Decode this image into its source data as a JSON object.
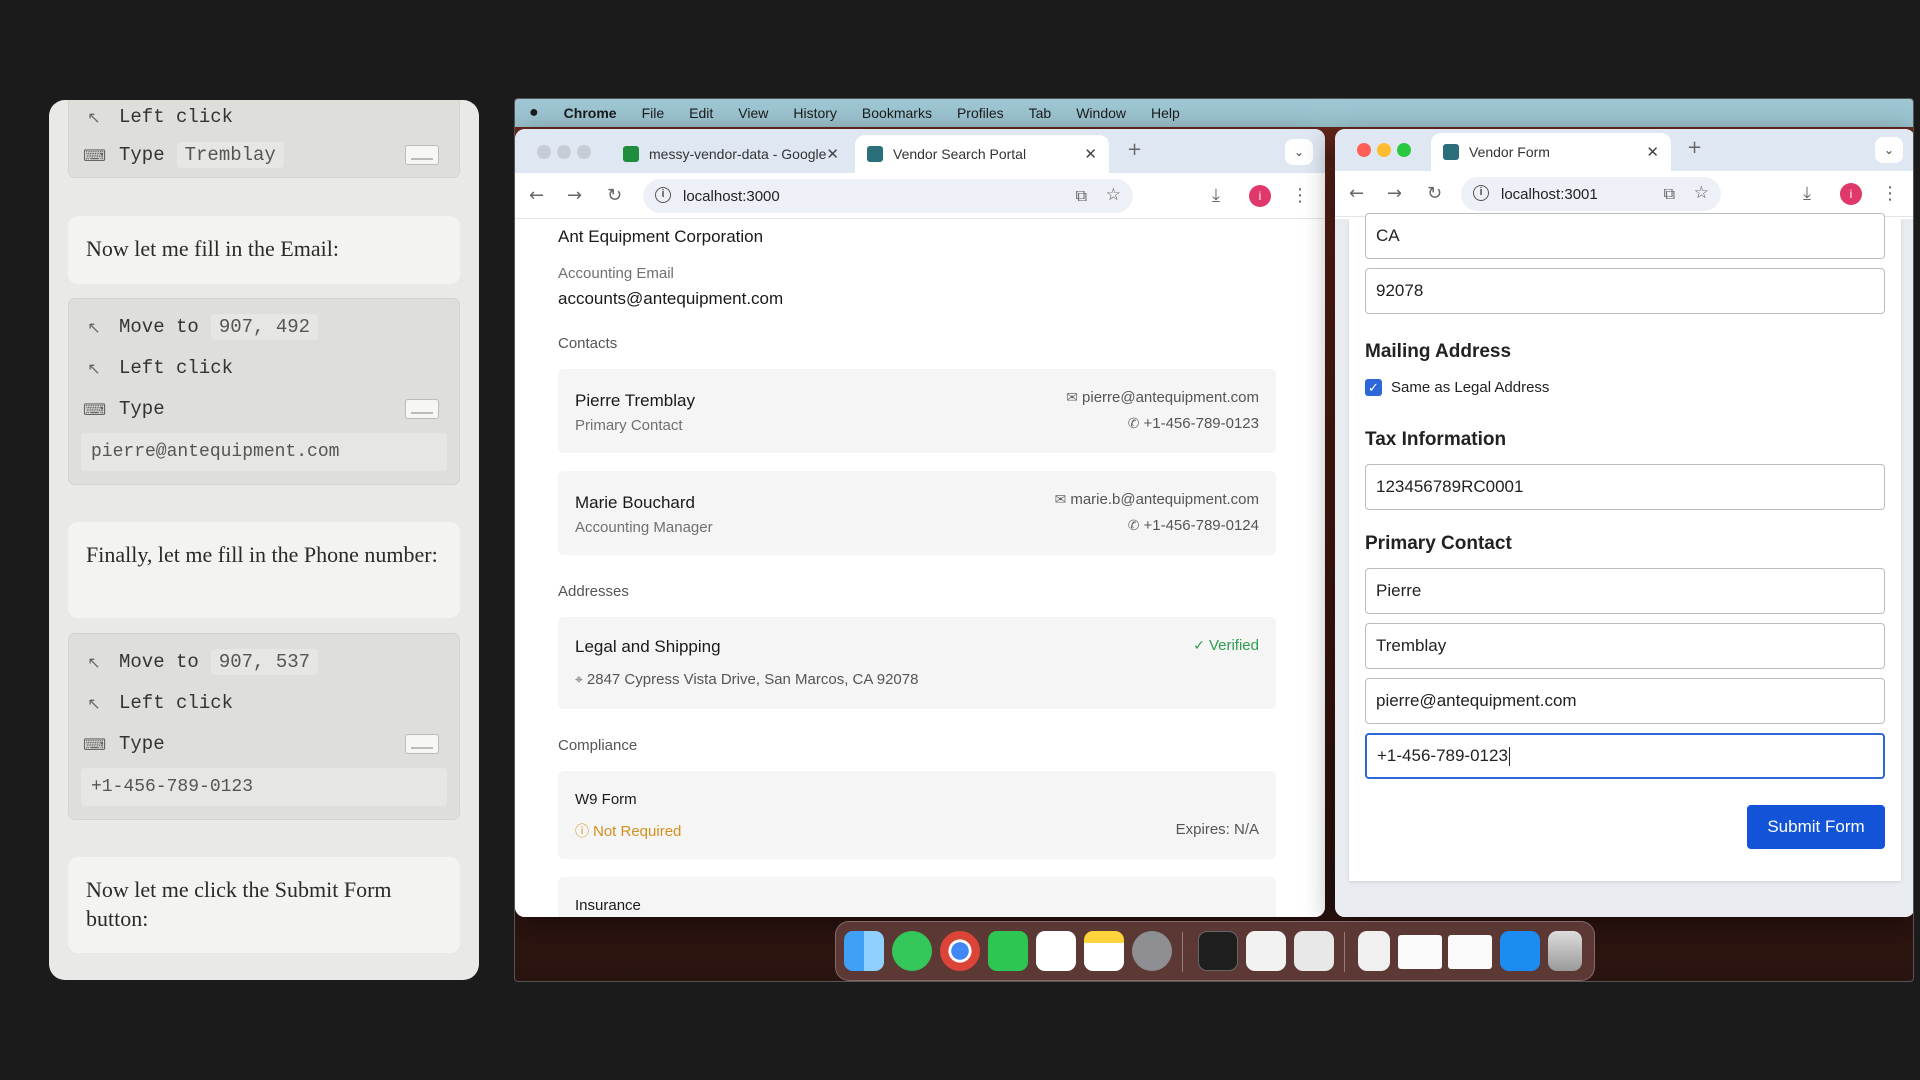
{
  "agent": {
    "step1": {
      "click_label": "Left click",
      "type_label": "Type",
      "typed_value": "Tremblay"
    },
    "msg_email": "Now let me fill in the Email:",
    "step2": {
      "move_label": "Move to",
      "move_coord": "907, 492",
      "click_label": "Left click",
      "type_label": "Type",
      "typed_value": "pierre@antequipment.com"
    },
    "msg_phone": "Finally, let me fill in the Phone number:",
    "step3": {
      "move_label": "Move to",
      "move_coord": "907, 537",
      "click_label": "Left click",
      "type_label": "Type",
      "typed_value": "+1-456-789-0123"
    },
    "msg_submit": "Now let me click the Submit Form button:"
  },
  "menubar": {
    "app": "Chrome",
    "items": [
      "File",
      "Edit",
      "View",
      "History",
      "Bookmarks",
      "Profiles",
      "Tab",
      "Window",
      "Help"
    ]
  },
  "window1": {
    "tabs": [
      {
        "label": "messy-vendor-data - Google",
        "favicon_color": "#1e8e3e"
      },
      {
        "label": "Vendor Search Portal",
        "favicon_color": "#2a6f7a"
      }
    ],
    "url": "localhost:3000",
    "profile_initial": "i",
    "company_name": "Ant Equipment Corporation",
    "accounting_email_label": "Accounting Email",
    "accounting_email": "accounts@antequipment.com",
    "contacts_heading": "Contacts",
    "contacts": [
      {
        "name": "Pierre Tremblay",
        "role": "Primary Contact",
        "email": "pierre@antequipment.com",
        "phone": "+1-456-789-0123"
      },
      {
        "name": "Marie Bouchard",
        "role": "Accounting Manager",
        "email": "marie.b@antequipment.com",
        "phone": "+1-456-789-0124"
      }
    ],
    "addresses_heading": "Addresses",
    "address": {
      "title": "Legal and Shipping",
      "status": "Verified",
      "line": "2847 Cypress Vista Drive, San Marcos, CA 92078"
    },
    "compliance_heading": "Compliance",
    "w9": {
      "title": "W9 Form",
      "status": "Not Required",
      "expires": "Expires: N/A"
    },
    "insurance_heading": "Insurance"
  },
  "window2": {
    "tab": {
      "label": "Vendor Form",
      "favicon_color": "#2a6f7a"
    },
    "url": "localhost:3001",
    "profile_initial": "i",
    "state_value": "CA",
    "zip_value": "92078",
    "mailing_heading": "Mailing Address",
    "same_as_legal_label": "Same as Legal Address",
    "same_as_legal_checked": true,
    "tax_heading": "Tax Information",
    "tax_value": "123456789RC0001",
    "contact_heading": "Primary Contact",
    "first_name": "Pierre",
    "last_name": "Tremblay",
    "email": "pierre@antequipment.com",
    "phone": "+1-456-789-0123",
    "submit_label": "Submit Form"
  },
  "colors": {
    "accent": "#1253d8",
    "verified": "#2e9e4f",
    "warning": "#d4901c",
    "profile": "#e0386a"
  }
}
